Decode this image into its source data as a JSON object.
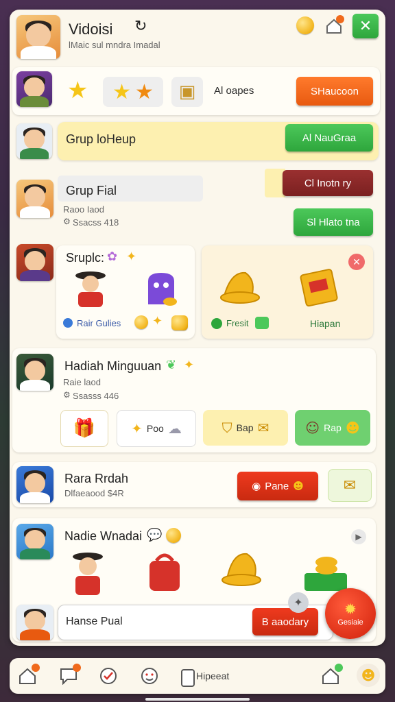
{
  "header": {
    "title": "Vidoisi",
    "subtitle": "lMaic sul mndra Imadal",
    "close_label": "✕"
  },
  "topbar": {
    "item_label": "Al oapes",
    "button_label": "SHaucoon"
  },
  "group_lookup": {
    "label": "Grup loHeup",
    "button_label": "Al NauGraa"
  },
  "group_final": {
    "title": "Grup Fial",
    "line1": "Raoo Iaod",
    "line2": "Ssacss 418",
    "button_top": "Cl Inotn ry",
    "button_bottom": "Sl Hlato tna"
  },
  "section_supplies": {
    "title": "Sruplc:",
    "left_caption": "Rair Gulies",
    "right_left_caption": "Fresit",
    "right_right_caption": "Hiapan"
  },
  "weekly": {
    "title": "Hadiah Minguuan",
    "line1": "Raie laod",
    "line2": "Ssasss 446",
    "tile2_label": "Poo",
    "tile3_label": "Bap",
    "tile4_label": "Rap"
  },
  "reward": {
    "title": "Rara Rrdah",
    "subtitle": "Dlfaeaood $4R",
    "button_label": "Pane"
  },
  "daily": {
    "title": "Nadie Wnadai"
  },
  "bottom_input": {
    "label": "Hanse Pual",
    "button_label": "B aaodary",
    "fab_label": "Gesiaie"
  },
  "nav": {
    "center_label": "Hipeeat"
  },
  "colors": {
    "accent_orange": "#e85a10",
    "accent_green": "#2ea63c",
    "accent_maroon": "#7a2020",
    "highlight_yellow": "#fdf0b0"
  }
}
